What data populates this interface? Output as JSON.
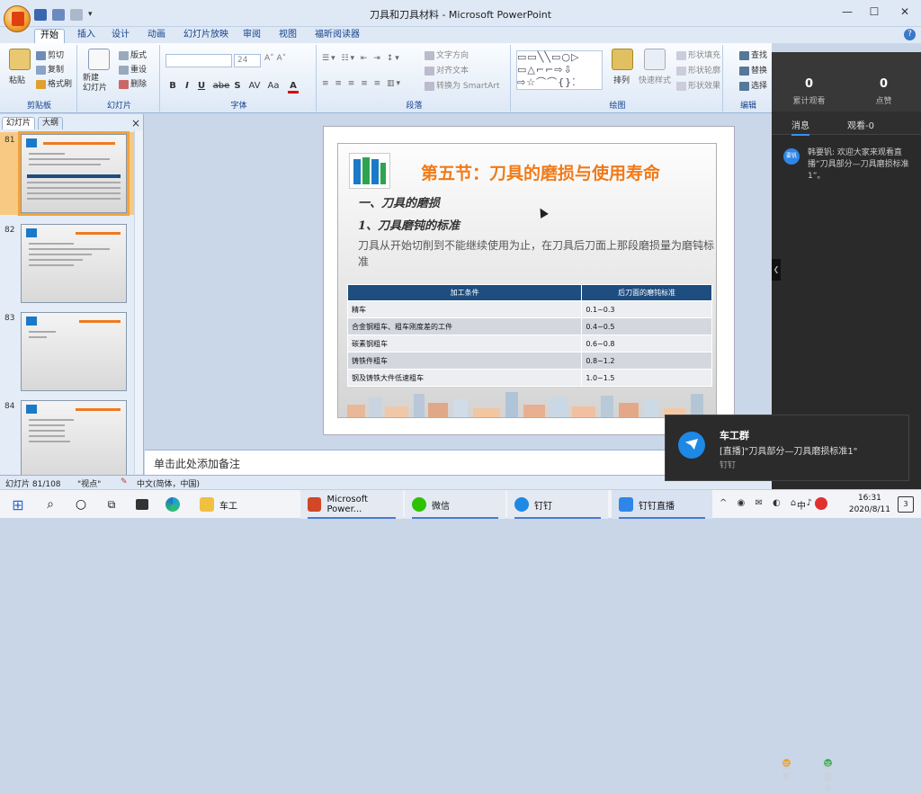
{
  "window": {
    "title": "刀具和刀具材料 - Microsoft PowerPoint",
    "minimize": "—",
    "maximize": "☐",
    "close": "✕",
    "help": "?"
  },
  "tabs": [
    "开始",
    "插入",
    "设计",
    "动画",
    "幻灯片放映",
    "审阅",
    "视图",
    "福昕阅读器"
  ],
  "ribbon": {
    "clipboard": {
      "label": "剪贴板",
      "paste": "粘贴",
      "cut": "剪切",
      "copy": "复制",
      "format_painter": "格式刷"
    },
    "slides": {
      "label": "幻灯片",
      "new_slide": "新建\n幻灯片",
      "layout": "版式",
      "reset": "重设",
      "delete": "删除"
    },
    "font": {
      "label": "字体",
      "font_size": "24",
      "buttons": [
        "B",
        "I",
        "U",
        "abe",
        "S",
        "AV",
        "Aa",
        "A"
      ]
    },
    "paragraph": {
      "label": "段落",
      "text_direction": "文字方向",
      "align_text": "对齐文本",
      "convert_smartart": "转换为 SmartArt"
    },
    "drawing": {
      "label": "绘图",
      "arrange": "排列",
      "quick_styles": "快速样式",
      "shape_fill": "形状填充",
      "shape_outline": "形状轮廓",
      "shape_effects": "形状效果"
    },
    "editing": {
      "label": "编辑",
      "find": "查找",
      "replace": "替换",
      "select": "选择"
    }
  },
  "panel": {
    "tab_slides": "幻灯片",
    "tab_outline": "大纲",
    "close": "×",
    "thumbs": [
      {
        "num": "81",
        "selected": true
      },
      {
        "num": "82",
        "selected": false
      },
      {
        "num": "83",
        "selected": false
      },
      {
        "num": "84",
        "selected": false
      }
    ]
  },
  "slide": {
    "title": "第五节：刀具的磨损与使用寿命",
    "heading1": "一、刀具的磨损",
    "heading2": "1、刀具磨钝的标准",
    "body": "刀具从开始切削到不能继续使用为止，在刀具后刀面上那段磨损量为磨钝标准",
    "table": {
      "headers": [
        "加工条件",
        "后刀面的磨钝标准"
      ],
      "rows": [
        [
          "精车",
          "0.1~0.3"
        ],
        [
          "合金钢粗车、粗车刚度差的工件",
          "0.4~0.5"
        ],
        [
          "碳素钢粗车",
          "0.6~0.8"
        ],
        [
          "铸铁件粗车",
          "0.8~1.2"
        ],
        [
          "钢及铸铁大件低速粗车",
          "1.0~1.5"
        ]
      ]
    }
  },
  "notes_placeholder": "单击此处添加备注",
  "status": {
    "slide": "幻灯片 81/108",
    "theme": "\"视点\"",
    "language": "中文(简体，中国)"
  },
  "live": {
    "views": "0",
    "views_label": "累计观看",
    "likes": "0",
    "likes_label": "点赞",
    "tab_messages": "消息",
    "tab_watching": "观看-0",
    "message_avatar": "要钒",
    "message": "韩要钒: 欢迎大家来观看直播“刀具部分—刀具磨损标准1”。",
    "signin": "签到",
    "answer_card": "答题卡"
  },
  "toast": {
    "title": "车工群",
    "body": "[直播]\"刀具部分—刀具磨损标准1\"",
    "app": "钉钉"
  },
  "taskbar": {
    "items": [
      "车工",
      "Microsoft Power...",
      "微信",
      "钉钉",
      "钉钉直播"
    ],
    "ime": "中",
    "time": "16:31",
    "date": "2020/8/11",
    "notifications": "3"
  },
  "colors": {
    "accent": "#15428b",
    "slide_title": "#f07a1a",
    "table_header": "#1e4d80",
    "live_bg": "#2a2a2a"
  }
}
